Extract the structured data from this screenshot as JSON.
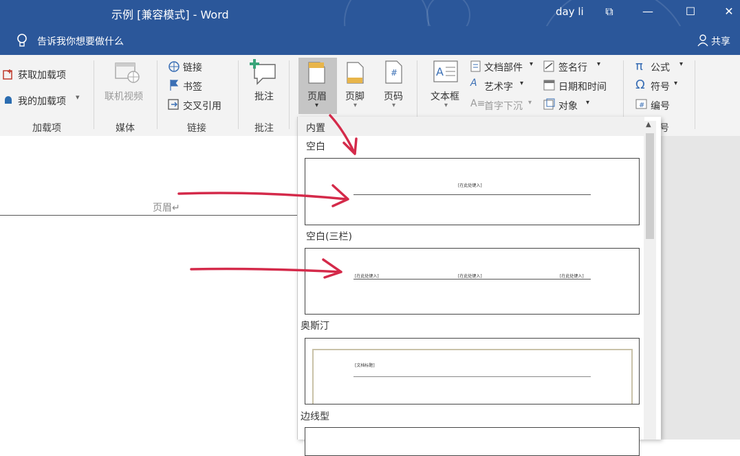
{
  "titlebar": {
    "doc_title": "示例 [兼容模式] - Word",
    "user": "day li",
    "restore_glyph": "⧉",
    "minimize_glyph": "—",
    "maximize_glyph": "☐",
    "close_glyph": "✕"
  },
  "tellbar": {
    "prompt": "告诉我你想要做什么",
    "share": "共享"
  },
  "ribbon": {
    "addins": {
      "get": "获取加载项",
      "mine": "我的加载项",
      "group": "加载项"
    },
    "media": {
      "online_video": "联机视频",
      "group": "媒体"
    },
    "links": {
      "link": "链接",
      "bookmark": "书签",
      "cross_ref": "交叉引用",
      "group": "链接"
    },
    "comments": {
      "comment": "批注",
      "group": "批注"
    },
    "header_footer": {
      "header": "页眉",
      "footer": "页脚",
      "page_number": "页码"
    },
    "text": {
      "textbox": "文本框",
      "doc_parts": "文档部件",
      "wordart": "艺术字",
      "drop_cap": "首字下沉",
      "signature": "签名行",
      "datetime": "日期和时间",
      "object": "对象"
    },
    "symbols": {
      "equation": "公式",
      "symbol": "符号",
      "number": "编号",
      "group_partial": "号"
    }
  },
  "document": {
    "header_text": "页眉↵"
  },
  "gallery": {
    "section": "内置",
    "items": [
      {
        "label": "空白",
        "placeholders": [
          "[在此处键入]"
        ]
      },
      {
        "label": "空白(三栏)",
        "placeholders": [
          "[在此处键入]",
          "[在此处键入]",
          "[在此处键入]"
        ]
      },
      {
        "label": "奥斯汀",
        "placeholders": [
          "[文档标题]"
        ]
      },
      {
        "label": "边线型",
        "placeholders": []
      }
    ]
  },
  "annotations": {
    "arrow_color": "#d42a4a"
  },
  "colors": {
    "brand": "#2b579a",
    "ribbon_bg": "#f3f3f3",
    "selected_tab": "#c5c5c5"
  }
}
